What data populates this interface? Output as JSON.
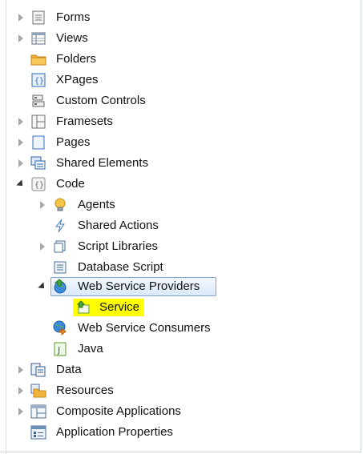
{
  "tree": {
    "forms": "Forms",
    "views": "Views",
    "folders": "Folders",
    "xpages": "XPages",
    "custom_controls": "Custom Controls",
    "framesets": "Framesets",
    "pages": "Pages",
    "shared_elements": "Shared Elements",
    "code": "Code",
    "agents": "Agents",
    "shared_actions": "Shared Actions",
    "script_libraries": "Script Libraries",
    "database_script": "Database Script",
    "web_service_providers": "Web Service Providers",
    "service": "Service",
    "web_service_consumers": "Web Service Consumers",
    "java": "Java",
    "data": "Data",
    "resources": "Resources",
    "composite_applications": "Composite Applications",
    "application_properties": "Application Properties"
  },
  "colors": {
    "selection_border": "#7da2ce",
    "highlight": "#ffff00",
    "folder": "#f0b43a"
  }
}
